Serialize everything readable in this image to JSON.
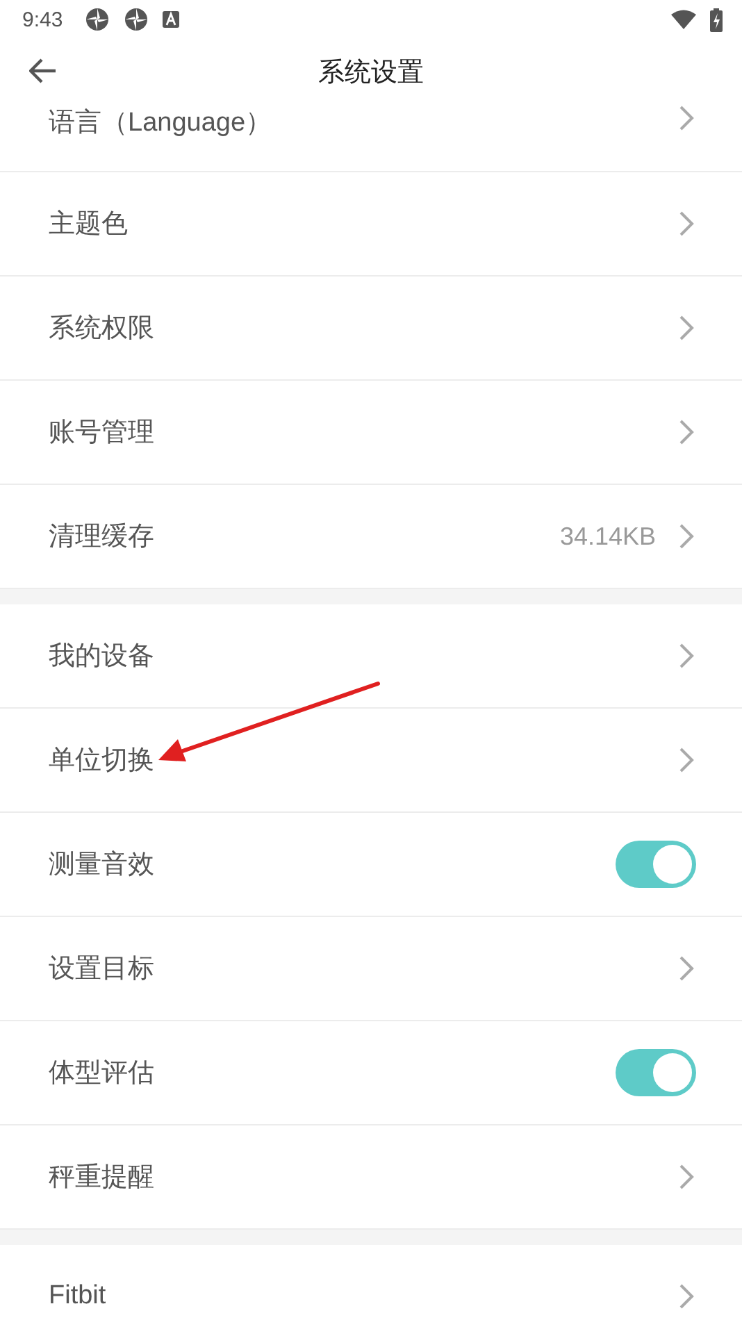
{
  "status_bar": {
    "time": "9:43"
  },
  "header": {
    "title": "系统设置"
  },
  "groups": [
    {
      "items": [
        {
          "kind": "link",
          "label": "语言（Language）"
        },
        {
          "kind": "link",
          "label": "主题色"
        },
        {
          "kind": "link",
          "label": "系统权限"
        },
        {
          "kind": "link",
          "label": "账号管理"
        },
        {
          "kind": "link",
          "label": "清理缓存",
          "value": "34.14KB"
        }
      ]
    },
    {
      "items": [
        {
          "kind": "link",
          "label": "我的设备"
        },
        {
          "kind": "link",
          "label": "单位切换"
        },
        {
          "kind": "toggle",
          "label": "测量音效",
          "on": true
        },
        {
          "kind": "link",
          "label": "设置目标"
        },
        {
          "kind": "toggle",
          "label": "体型评估",
          "on": true
        },
        {
          "kind": "link",
          "label": "秤重提醒"
        }
      ]
    },
    {
      "items": [
        {
          "kind": "link",
          "label": "Fitbit"
        }
      ]
    }
  ]
}
